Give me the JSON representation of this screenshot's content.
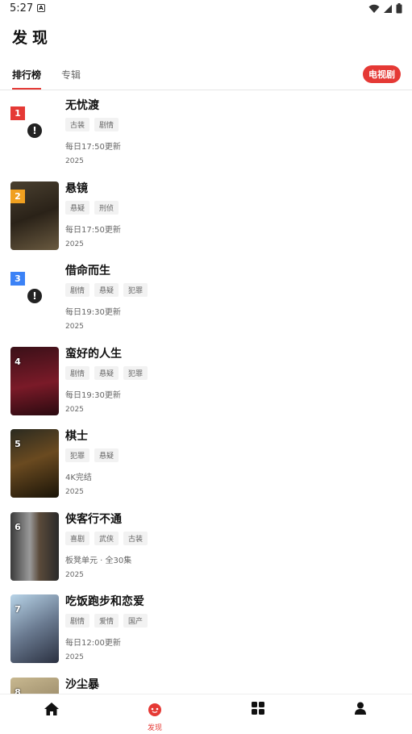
{
  "status": {
    "time": "5:27"
  },
  "header": {
    "title": "发现"
  },
  "tabs": [
    {
      "label": "排行榜"
    },
    {
      "label": "专辑"
    }
  ],
  "category_pill": "电视剧",
  "items": [
    {
      "rank": "1",
      "title": "无忧渡",
      "tags": [
        "古装",
        "剧情"
      ],
      "update": "每日17:50更新",
      "year": "2025",
      "rank_color": "#e53935",
      "poster": "error"
    },
    {
      "rank": "2",
      "title": "悬镜",
      "tags": [
        "悬疑",
        "刑侦"
      ],
      "update": "每日17:50更新",
      "year": "2025",
      "rank_color": "#f0a020",
      "poster": "image"
    },
    {
      "rank": "3",
      "title": "借命而生",
      "tags": [
        "剧情",
        "悬疑",
        "犯罪"
      ],
      "update": "每日19:30更新",
      "year": "2025",
      "rank_color": "#3b82f6",
      "poster": "error"
    },
    {
      "rank": "4",
      "title": "蛮好的人生",
      "tags": [
        "剧情",
        "悬疑",
        "犯罪"
      ],
      "update": "每日19:30更新",
      "year": "2025",
      "rank_color": "",
      "poster": "image"
    },
    {
      "rank": "5",
      "title": "棋士",
      "tags": [
        "犯罪",
        "悬疑"
      ],
      "update": "4K完结",
      "year": "2025",
      "rank_color": "",
      "poster": "image"
    },
    {
      "rank": "6",
      "title": "侠客行不通",
      "tags": [
        "喜剧",
        "武侠",
        "古装"
      ],
      "update": "板凳单元 · 全30集",
      "year": "2025",
      "rank_color": "",
      "poster": "image"
    },
    {
      "rank": "7",
      "title": "吃饭跑步和恋爱",
      "tags": [
        "剧情",
        "爱情",
        "国产"
      ],
      "update": "每日12:00更新",
      "year": "2025",
      "rank_color": "",
      "poster": "image"
    },
    {
      "rank": "8",
      "title": "沙尘暴",
      "tags": [],
      "update": "",
      "year": "",
      "rank_color": "",
      "poster": "image"
    }
  ],
  "bottom_nav": [
    {
      "icon": "home-icon",
      "label": ""
    },
    {
      "icon": "discover-icon",
      "label": "发现"
    },
    {
      "icon": "grid-icon",
      "label": ""
    },
    {
      "icon": "user-icon",
      "label": ""
    }
  ],
  "colors": {
    "accent": "#e53935"
  }
}
